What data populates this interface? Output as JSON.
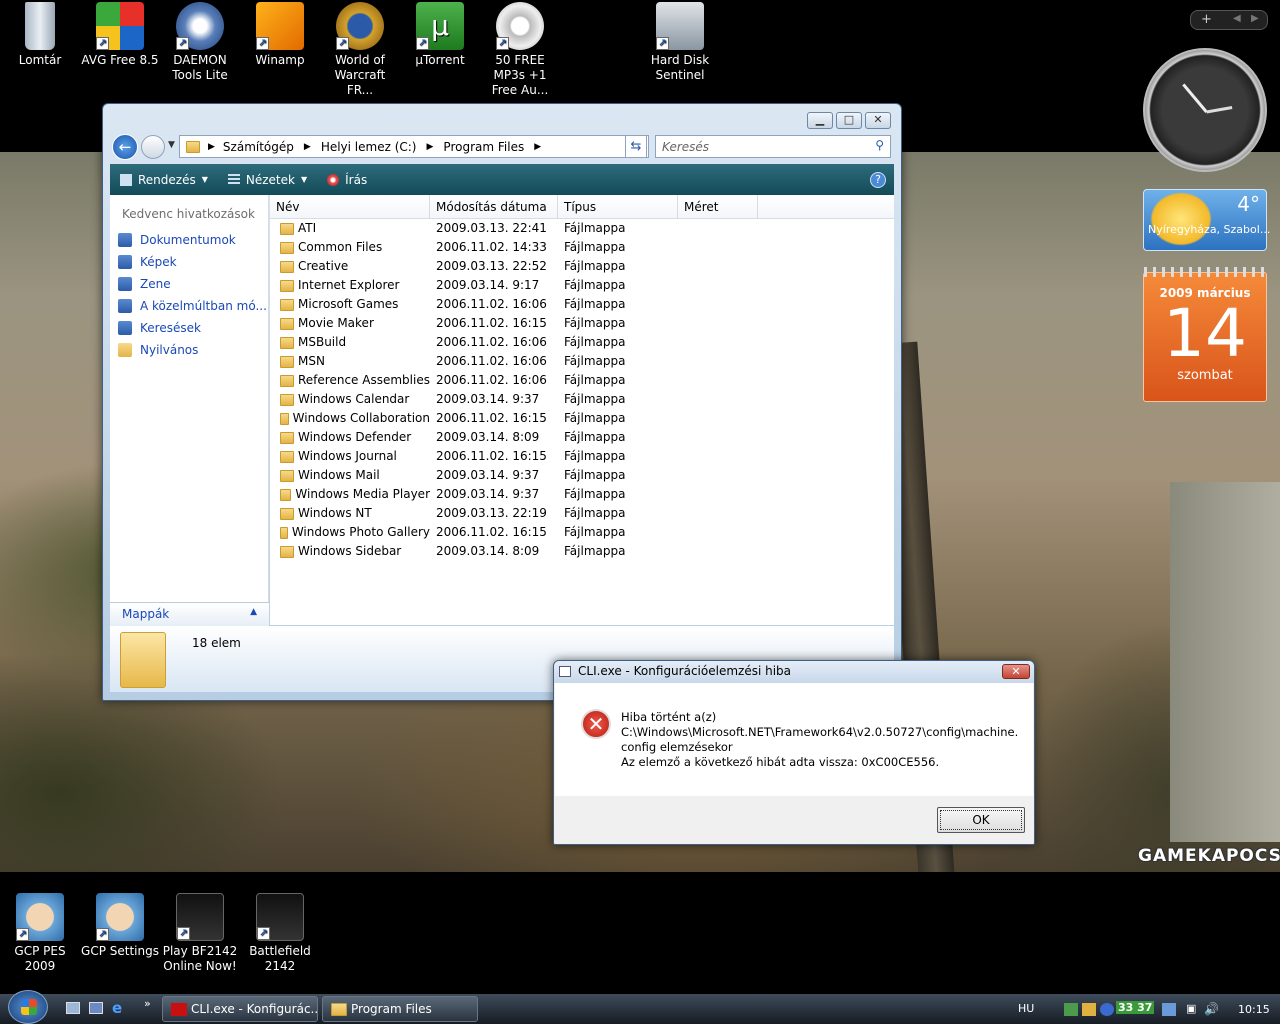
{
  "desktop": {
    "top_icons": [
      {
        "label": "Lomtár"
      },
      {
        "label": "AVG Free 8.5"
      },
      {
        "label": "DAEMON Tools Lite"
      },
      {
        "label": "Winamp"
      },
      {
        "label": "World of Warcraft FR..."
      },
      {
        "label": "µTorrent"
      },
      {
        "label": "50 FREE MP3s +1 Free Au..."
      },
      {
        "label": "Hard Disk Sentinel"
      }
    ],
    "bottom_icons": [
      {
        "label": "GCP PES 2009"
      },
      {
        "label": "GCP Settings"
      },
      {
        "label": "Play BF2142 Online Now!"
      },
      {
        "label": "Battlefield 2142"
      }
    ],
    "wallpaper_brand": "GAMEKAPOCS"
  },
  "explorer": {
    "breadcrumb": [
      "Számítógép",
      "Helyi lemez (C:)",
      "Program Files"
    ],
    "search_placeholder": "Keresés",
    "toolbar": {
      "organize": "Rendezés",
      "views": "Nézetek",
      "burn": "Írás"
    },
    "nav": {
      "favorites_title": "Kedvenc hivatkozások",
      "links": [
        "Dokumentumok",
        "Képek",
        "Zene",
        "A közelmúltban mó...",
        "Keresések",
        "Nyilvános"
      ],
      "folders_label": "Mappák"
    },
    "columns": [
      "Név",
      "Módosítás dátuma",
      "Típus",
      "Méret"
    ],
    "rows": [
      {
        "name": "ATI",
        "date": "2009.03.13. 22:41",
        "type": "Fájlmappa"
      },
      {
        "name": "Common Files",
        "date": "2006.11.02. 14:33",
        "type": "Fájlmappa"
      },
      {
        "name": "Creative",
        "date": "2009.03.13. 22:52",
        "type": "Fájlmappa"
      },
      {
        "name": "Internet Explorer",
        "date": "2009.03.14. 9:17",
        "type": "Fájlmappa"
      },
      {
        "name": "Microsoft Games",
        "date": "2006.11.02. 16:06",
        "type": "Fájlmappa"
      },
      {
        "name": "Movie Maker",
        "date": "2006.11.02. 16:15",
        "type": "Fájlmappa"
      },
      {
        "name": "MSBuild",
        "date": "2006.11.02. 16:06",
        "type": "Fájlmappa"
      },
      {
        "name": "MSN",
        "date": "2006.11.02. 16:06",
        "type": "Fájlmappa"
      },
      {
        "name": "Reference Assemblies",
        "date": "2006.11.02. 16:06",
        "type": "Fájlmappa"
      },
      {
        "name": "Windows Calendar",
        "date": "2009.03.14. 9:37",
        "type": "Fájlmappa"
      },
      {
        "name": "Windows Collaboration",
        "date": "2006.11.02. 16:15",
        "type": "Fájlmappa"
      },
      {
        "name": "Windows Defender",
        "date": "2009.03.14. 8:09",
        "type": "Fájlmappa"
      },
      {
        "name": "Windows Journal",
        "date": "2006.11.02. 16:15",
        "type": "Fájlmappa"
      },
      {
        "name": "Windows Mail",
        "date": "2009.03.14. 9:37",
        "type": "Fájlmappa"
      },
      {
        "name": "Windows Media Player",
        "date": "2009.03.14. 9:37",
        "type": "Fájlmappa"
      },
      {
        "name": "Windows NT",
        "date": "2009.03.13. 22:19",
        "type": "Fájlmappa"
      },
      {
        "name": "Windows Photo Gallery",
        "date": "2006.11.02. 16:15",
        "type": "Fájlmappa"
      },
      {
        "name": "Windows Sidebar",
        "date": "2009.03.14. 8:09",
        "type": "Fájlmappa"
      }
    ],
    "status": "18 elem"
  },
  "dialog": {
    "title": "CLI.exe - Konfigurációelemzési hiba",
    "lines": [
      "Hiba történt a(z)",
      "C:\\Windows\\Microsoft.NET\\Framework64\\v2.0.50727\\config\\machine.",
      "config elemzésekor",
      "Az elemző a következő hibát adta vissza: 0xC00CE556."
    ],
    "ok": "OK"
  },
  "gadgets": {
    "weather": {
      "temp": "4°",
      "location": "Nyíregyháza, Szabol..."
    },
    "calendar": {
      "month": "2009 március",
      "day": "14",
      "weekday": "szombat"
    }
  },
  "taskbar": {
    "tasks": [
      "CLI.exe - Konfigurác...",
      "Program Files"
    ],
    "lang": "HU",
    "tray_counter": "33 37",
    "time": "10:15"
  },
  "colors": {
    "accent": "#2e6c7c",
    "error": "#c0281c",
    "calendar": "#e8671f"
  }
}
